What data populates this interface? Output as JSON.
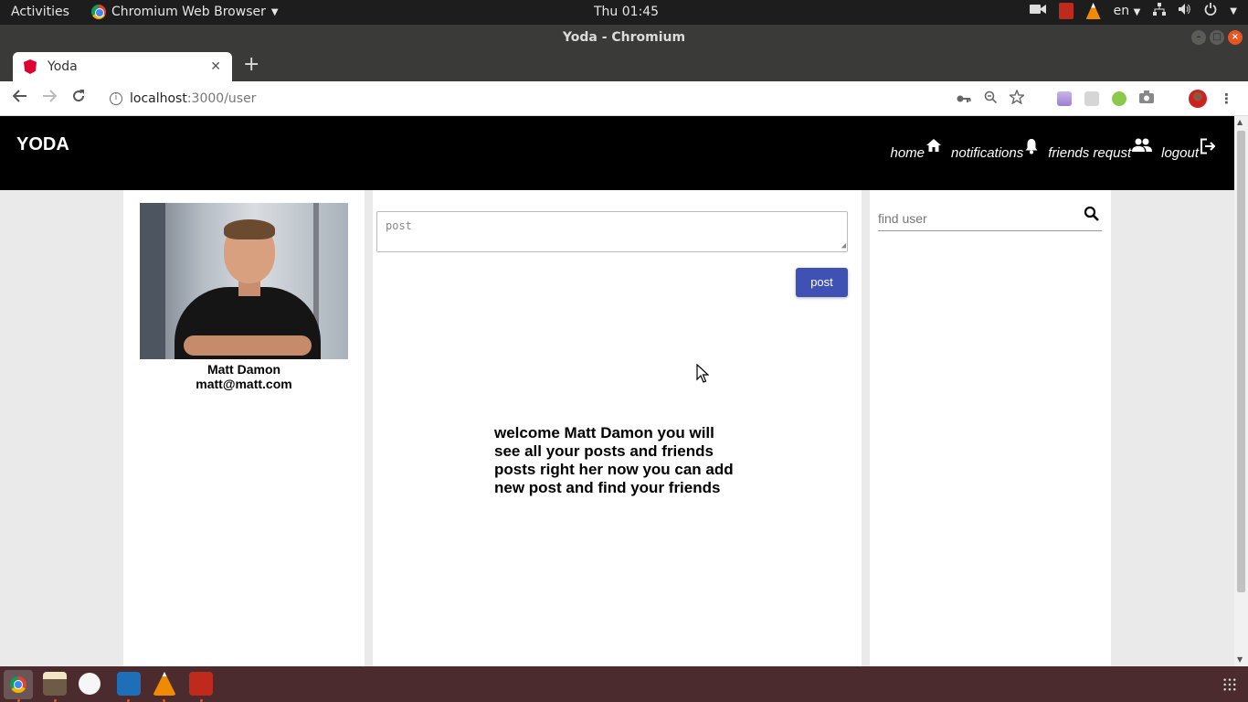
{
  "system": {
    "activities": "Activities",
    "app_menu": "Chromium Web Browser",
    "clock": "Thu 01:45",
    "lang": "en"
  },
  "window": {
    "title": "Yoda - Chromium"
  },
  "tabs": [
    {
      "title": "Yoda"
    }
  ],
  "address": {
    "host": "localhost",
    "path": ":3000/user"
  },
  "app": {
    "brand": "YODA",
    "nav": [
      {
        "label": "home",
        "icon": "home-icon"
      },
      {
        "label": "notifications",
        "icon": "bell-icon"
      },
      {
        "label": "friends requst",
        "icon": "people-icon"
      },
      {
        "label": "logout",
        "icon": "logout-icon"
      }
    ],
    "profile": {
      "name": "Matt Damon",
      "email": "matt@matt.com"
    },
    "composer": {
      "placeholder": "post",
      "button": "post"
    },
    "welcome": "welcome Matt Damon you will see all your posts and friends posts right her now you can add new post and find your friends",
    "search": {
      "placeholder": "find user"
    },
    "colors": {
      "header": "#000000",
      "accent": "#3f51b5",
      "page_bg": "#eaeaea"
    }
  }
}
